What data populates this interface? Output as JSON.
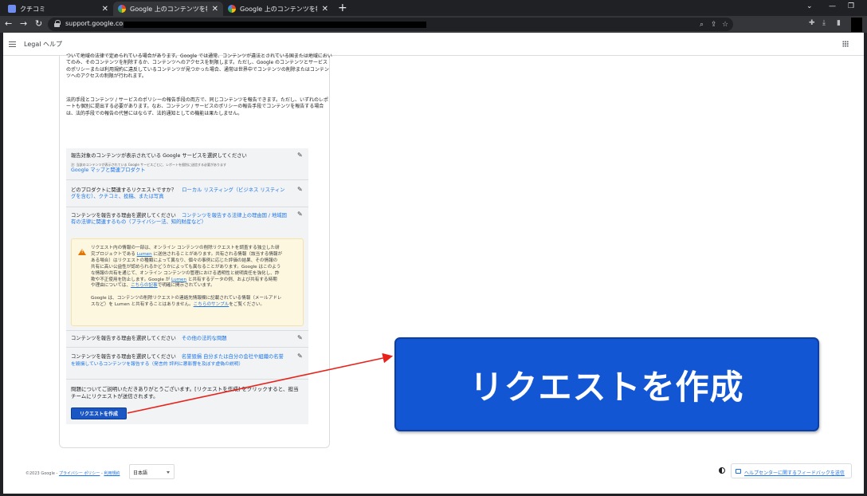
{
  "browser": {
    "tabs": [
      {
        "label": "クチコミ"
      },
      {
        "label": "Google 上のコンテンツを報告 - Legal ヘ"
      },
      {
        "label": "Google 上のコンテンツを報告 - Legal ヘ"
      }
    ],
    "url": "support.google.com"
  },
  "header": {
    "title": "Legal ヘルプ"
  },
  "content": {
    "para1": "ついて地域の法律で定められている場合があります。Google では通常、コンテンツが違法とされている国または地域においてのみ、そのコンテンツを削除するか、コンテンツへのアクセスを制限します。ただし、Google のコンテンツとサービスのポリシーまたは利用規約に違反しているコンテンツが見つかった場合、通常は世界中でコンテンツの削除またはコンテンツへのアクセスの制限が行われます。",
    "para2": "法的手段とコンテンツ / サービスのポリシーの報告手段の両方で、同じコンテンツを報告できます。ただし、いずれのレポートも個別に提出する必要があります。なお、コンテンツ / サービスのポリシーの報告手段でコンテンツを報告する場合は、法的手段での報告の代替にはならず、法的通知としての機能は果たしません。"
  },
  "form": {
    "q1": {
      "label": "報告対象のコンテンツが表示されている Google サービスを選択してください",
      "note": "注: 当該のコンテンツが表示されている Google サービスごとに、レポートを個別に送信する必要があります",
      "answer": "Google マップと関連プロダクト"
    },
    "q2": {
      "label": "どのプロダクトに関連するリクエストですか？",
      "answer_line1": "ローカル リスティング（ビジネス リスティン",
      "answer_line2": "グを含む）、クチコミ、投稿、または写真"
    },
    "q3": {
      "label": "コンテンツを報告する理由を選択してください",
      "answer_line1": "コンテンツを報告する法律上の理由国 / 地域固",
      "answer_line2": "有の法律に関連するもの（プライバシー法、知的財産など）"
    },
    "warning": {
      "para1_lines": [
        "リクエスト内の情報の一部は、オンライン コンテンツの削除リクエストを調査する独立した研",
        "究プロジェクトである Lumen に送信されることがあります。共有される情報（該当する情報が",
        "ある場合）はリクエストの種類によって異なり、個々の事例に応じた評価の結果、その情報の",
        "共有に高い公益性が認められるかどうかによっても異なることがあります。Google はこのよう",
        "な情報の共有を通じて、オンライン コンテンツの管理における透明性と説明責任を強化し、詐",
        "欺や不正使用を防止します。Google が Lumen と共有するデータの例、および共有する時期",
        "や理由については、こちらの記事で明確に開示されています。"
      ],
      "lumen": "Lumen",
      "article_link": "こちらの記事",
      "para2_line1": "Google は、コンテンツの削除リクエストの連絡先情報欄に記載されている情報（メールアドレ",
      "para2_line2": "スなど）を Lumen と共有することはありません。",
      "sample_link": "こちらのサンプル",
      "para2_tail": "をご覧ください。"
    },
    "q4": {
      "label": "コンテンツを報告する理由を選択してください",
      "answer": "その他の法的な問題"
    },
    "q5": {
      "label": "コンテンツを報告する理由を選択してください",
      "answer_line1": "名誉毀損 自分または自分の会社や組織の名誉",
      "answer_line2": "を毀損しているコンテンツを報告する（発言的 評判に悪影響を及ぼす虚偽の説明）"
    },
    "submit_text": "問題についてご説明いただきありがとうございます。[リクエストを作成] をクリックすると、担当チームにリクエストが送信されます。",
    "submit_label": "リクエストを作成"
  },
  "callout": {
    "label": "リクエストを作成",
    "arrow_color": "#e8221b"
  },
  "footer": {
    "copyright": "©2023 Google -",
    "privacy": "プライバシー ポリシー",
    "sep": "-",
    "terms": "利用規約",
    "language": "日本語",
    "feedback": "ヘルプセンターに関するフィードバックを送信"
  }
}
